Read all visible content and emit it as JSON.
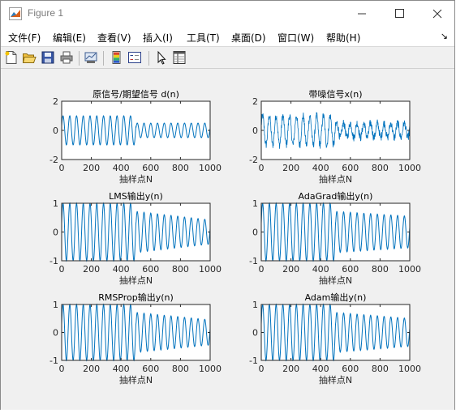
{
  "window": {
    "title": "Figure 1"
  },
  "menu": [
    "文件(F)",
    "编辑(E)",
    "查看(V)",
    "插入(I)",
    "工具(T)",
    "桌面(D)",
    "窗口(W)",
    "帮助(H)"
  ],
  "dock_arrow": "↘",
  "toolbar": [
    "new-file-icon",
    "open-folder-icon",
    "save-icon",
    "print-icon",
    "link-plot-icon",
    "colorbar-icon",
    "legend-icon",
    "pointer-icon",
    "property-inspector-icon"
  ],
  "colors": {
    "line": "#0072BD",
    "axes_bg": "#ffffff",
    "figure_bg": "#f0f0f0"
  },
  "chart_data": [
    {
      "type": "line",
      "title": "原信号/期望信号 d(n)",
      "xlabel": "抽样点N",
      "ylabel": "",
      "xlim": [
        0,
        1000
      ],
      "ylim": [
        -2,
        2
      ],
      "xticks": [
        "0",
        "200",
        "400",
        "600",
        "800",
        "1000"
      ],
      "yticks": [
        "-2",
        "0",
        "2"
      ],
      "series": [
        {
          "cycles_first_half": 11,
          "amp_first_half": 1.0,
          "cycles_second_half": 11,
          "amp_second_half": 0.5,
          "switch_at": 500,
          "noise": 0
        }
      ]
    },
    {
      "type": "line",
      "title": "带噪信号x(n)",
      "xlabel": "抽样点N",
      "ylabel": "",
      "xlim": [
        0,
        1000
      ],
      "ylim": [
        -2,
        2
      ],
      "xticks": [
        "0",
        "200",
        "400",
        "600",
        "800",
        "1000"
      ],
      "yticks": [
        "-2",
        "0",
        "2"
      ],
      "series": [
        {
          "cycles_first_half": 11,
          "amp_first_half": 1.0,
          "cycles_second_half": 11,
          "amp_second_half": 0.5,
          "switch_at": 500,
          "noise": 0.28
        }
      ]
    },
    {
      "type": "line",
      "title": "LMS输出y(n)",
      "xlabel": "抽样点N",
      "ylabel": "",
      "xlim": [
        0,
        1000
      ],
      "ylim": [
        -1,
        1
      ],
      "xticks": [
        "0",
        "200",
        "400",
        "600",
        "800",
        "1000"
      ],
      "yticks": [
        "-1",
        "0",
        "1"
      ],
      "series": [
        {
          "cycles_first_half": 11,
          "amp_first_half": 1.0,
          "cycles_second_half": 11,
          "amp_second_half": 0.72,
          "switch_at": 500,
          "decay_to": 0.42,
          "noise": 0
        }
      ]
    },
    {
      "type": "line",
      "title": "AdaGrad输出y(n)",
      "xlabel": "抽样点N",
      "ylabel": "",
      "xlim": [
        0,
        1000
      ],
      "ylim": [
        -1,
        1
      ],
      "xticks": [
        "0",
        "200",
        "400",
        "600",
        "800",
        "1000"
      ],
      "yticks": [
        "-1",
        "0",
        "1"
      ],
      "series": [
        {
          "cycles_first_half": 11,
          "amp_first_half": 1.0,
          "cycles_second_half": 11,
          "amp_second_half": 0.72,
          "switch_at": 500,
          "decay_to": 0.55,
          "noise": 0
        }
      ]
    },
    {
      "type": "line",
      "title": "RMSProp输出y(n)",
      "xlabel": "抽样点N",
      "ylabel": "",
      "xlim": [
        0,
        1000
      ],
      "ylim": [
        -1,
        1
      ],
      "xticks": [
        "0",
        "200",
        "400",
        "600",
        "800",
        "1000"
      ],
      "yticks": [
        "-1",
        "0",
        "1"
      ],
      "series": [
        {
          "cycles_first_half": 11,
          "amp_first_half": 1.0,
          "cycles_second_half": 11,
          "amp_second_half": 0.72,
          "switch_at": 500,
          "decay_to": 0.45,
          "noise": 0
        }
      ]
    },
    {
      "type": "line",
      "title": "Adam输出y(n)",
      "xlabel": "抽样点N",
      "ylabel": "",
      "xlim": [
        0,
        1000
      ],
      "ylim": [
        -1,
        1
      ],
      "xticks": [
        "0",
        "200",
        "400",
        "600",
        "800",
        "1000"
      ],
      "yticks": [
        "-1",
        "0",
        "1"
      ],
      "series": [
        {
          "cycles_first_half": 11,
          "amp_first_half": 1.0,
          "cycles_second_half": 11,
          "amp_second_half": 0.72,
          "switch_at": 500,
          "decay_to": 0.5,
          "noise": 0
        }
      ]
    }
  ]
}
